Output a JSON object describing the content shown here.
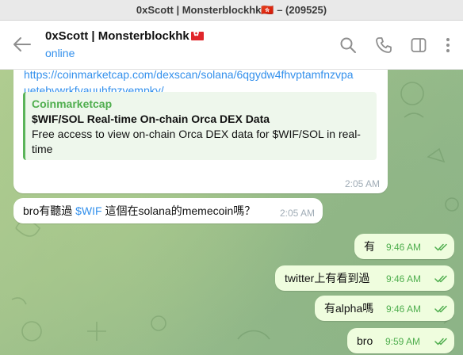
{
  "window": {
    "title": "0xScott | Monsterblockhk🇭🇰 – (209525)"
  },
  "header": {
    "name": "0xScott | Monsterblockhk",
    "status": "online"
  },
  "messages": [
    {
      "link": "https://coinmarketcap.com/dexscan/solana/6qgydw4fhvptamfnzvpauetebvwrkfvauuhfnzvempky/",
      "link_line1": "https://coinmarketcap.com/dexscan/solana/6qgydw4fhvptamfnzvpa",
      "link_line2": "uetebvwrkfvauuhfnzvempky/",
      "preview": {
        "site": "Coinmarketcap",
        "title": "$WIF/SOL Real-time On-chain Orca DEX Data",
        "desc_line1": "Free access to view on-chain Orca DEX data for $WIF/SOL in real-",
        "desc_line2": "time"
      },
      "time": "2:05 AM"
    },
    {
      "text_before": "bro有聽過 ",
      "cashtag": "$WIF",
      "text_after": " 這個在solana的memecoin嗎？",
      "time": "2:05 AM"
    },
    {
      "text": "有",
      "time": "9:46 AM"
    },
    {
      "text": "twitter上有看到過",
      "time": "9:46 AM"
    },
    {
      "text": "有alpha嗎",
      "time": "9:46 AM"
    },
    {
      "text": "bro",
      "time": "9:59 AM"
    }
  ],
  "colors": {
    "accent": "#3390ec",
    "outgoing_bubble": "#effdde",
    "read_check": "#4fae4e",
    "link_preview_bar": "#5bb45a"
  },
  "icons": [
    "back-arrow-icon",
    "flag-hk-icon",
    "search-icon",
    "phone-icon",
    "sidebar-toggle-icon",
    "more-vertical-icon",
    "double-check-icon"
  ]
}
